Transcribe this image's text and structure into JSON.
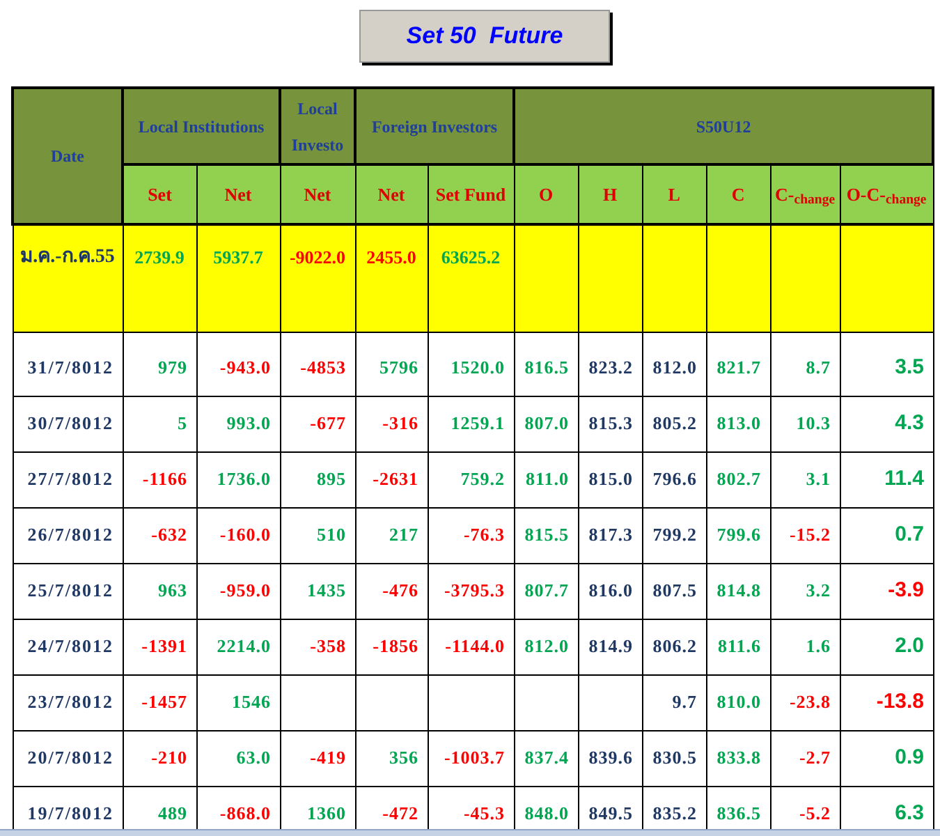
{
  "title": "Set 50  Future",
  "header": {
    "groups": [
      "Date",
      "Local Institutions",
      "Local Investo",
      "Foreign Investors",
      "S50U12"
    ],
    "columns": [
      "Set",
      "Net",
      "Net",
      "Net",
      "Set Fund",
      "O",
      "H",
      "L",
      "C",
      "C-$_{change}$",
      "O-C-$_{change}$"
    ]
  },
  "summary": {
    "label": "ม.ค.-ก.ค.55",
    "values": [
      {
        "text": "2739.9",
        "color": "#00a651"
      },
      {
        "text": "5937.7",
        "color": "#00a651"
      },
      {
        "text": "-9022.0",
        "color": "#ff0000"
      },
      {
        "text": "2455.0",
        "color": "#ff0000"
      },
      {
        "text": "63625.2",
        "color": "#00a651"
      }
    ]
  },
  "rows": [
    {
      "date": "31/7/8012",
      "cells": [
        {
          "text": "979",
          "color": "#00a651"
        },
        {
          "text": "-943.0",
          "color": "#ff0000"
        },
        {
          "text": "-4853",
          "color": "#ff0000"
        },
        {
          "text": "5796",
          "color": "#00a651"
        },
        {
          "text": "1520.0",
          "color": "#00a651"
        },
        {
          "text": "816.5",
          "color": "#00a651"
        },
        {
          "text": "823.2",
          "color": "#1f3864"
        },
        {
          "text": "812.0",
          "color": "#1f3864"
        },
        {
          "text": "821.7",
          "color": "#00a651"
        },
        {
          "text": "8.7",
          "color": "#00a651"
        },
        {
          "text": "3.5",
          "color": "#00a651"
        }
      ]
    },
    {
      "date": "30/7/8012",
      "cells": [
        {
          "text": "5",
          "color": "#00a651"
        },
        {
          "text": "993.0",
          "color": "#00a651"
        },
        {
          "text": "-677",
          "color": "#ff0000"
        },
        {
          "text": "-316",
          "color": "#ff0000"
        },
        {
          "text": "1259.1",
          "color": "#00a651"
        },
        {
          "text": "807.0",
          "color": "#00a651"
        },
        {
          "text": "815.3",
          "color": "#1f3864"
        },
        {
          "text": "805.2",
          "color": "#1f3864"
        },
        {
          "text": "813.0",
          "color": "#00a651"
        },
        {
          "text": "10.3",
          "color": "#00a651"
        },
        {
          "text": "4.3",
          "color": "#00a651"
        }
      ]
    },
    {
      "date": "27/7/8012",
      "cells": [
        {
          "text": "-1166",
          "color": "#ff0000"
        },
        {
          "text": "1736.0",
          "color": "#00a651"
        },
        {
          "text": "895",
          "color": "#00a651"
        },
        {
          "text": "-2631",
          "color": "#ff0000"
        },
        {
          "text": "759.2",
          "color": "#00a651"
        },
        {
          "text": "811.0",
          "color": "#00a651"
        },
        {
          "text": "815.0",
          "color": "#1f3864"
        },
        {
          "text": "796.6",
          "color": "#1f3864"
        },
        {
          "text": "802.7",
          "color": "#00a651"
        },
        {
          "text": "3.1",
          "color": "#00a651"
        },
        {
          "text": "11.4",
          "color": "#00a651"
        }
      ]
    },
    {
      "date": "26/7/8012",
      "cells": [
        {
          "text": "-632",
          "color": "#ff0000"
        },
        {
          "text": "-160.0",
          "color": "#ff0000"
        },
        {
          "text": "510",
          "color": "#00a651"
        },
        {
          "text": "217",
          "color": "#00a651"
        },
        {
          "text": "-76.3",
          "color": "#ff0000"
        },
        {
          "text": "815.5",
          "color": "#00a651"
        },
        {
          "text": "817.3",
          "color": "#1f3864"
        },
        {
          "text": "799.2",
          "color": "#1f3864"
        },
        {
          "text": "799.6",
          "color": "#00a651"
        },
        {
          "text": "-15.2",
          "color": "#ff0000"
        },
        {
          "text": "0.7",
          "color": "#00a651"
        }
      ]
    },
    {
      "date": "25/7/8012",
      "cells": [
        {
          "text": "963",
          "color": "#00a651"
        },
        {
          "text": "-959.0",
          "color": "#ff0000"
        },
        {
          "text": "1435",
          "color": "#00a651"
        },
        {
          "text": "-476",
          "color": "#ff0000"
        },
        {
          "text": "-3795.3",
          "color": "#ff0000"
        },
        {
          "text": "807.7",
          "color": "#00a651"
        },
        {
          "text": "816.0",
          "color": "#1f3864"
        },
        {
          "text": "807.5",
          "color": "#1f3864"
        },
        {
          "text": "814.8",
          "color": "#00a651"
        },
        {
          "text": "3.2",
          "color": "#00a651"
        },
        {
          "text": "-3.9",
          "color": "#ff0000"
        }
      ]
    },
    {
      "date": "24/7/8012",
      "cells": [
        {
          "text": "-1391",
          "color": "#ff0000"
        },
        {
          "text": "2214.0",
          "color": "#00a651"
        },
        {
          "text": "-358",
          "color": "#ff0000"
        },
        {
          "text": "-1856",
          "color": "#ff0000"
        },
        {
          "text": "-1144.0",
          "color": "#ff0000"
        },
        {
          "text": "812.0",
          "color": "#00a651"
        },
        {
          "text": "814.9",
          "color": "#1f3864"
        },
        {
          "text": "806.2",
          "color": "#1f3864"
        },
        {
          "text": "811.6",
          "color": "#00a651"
        },
        {
          "text": "1.6",
          "color": "#00a651"
        },
        {
          "text": "2.0",
          "color": "#00a651"
        }
      ]
    },
    {
      "date": "23/7/8012",
      "cells": [
        {
          "text": "-1457",
          "color": "#ff0000"
        },
        {
          "text": "1546",
          "color": "#00a651"
        },
        null,
        null,
        null,
        null,
        null,
        {
          "text": "9.7",
          "color": "#1f3864"
        },
        {
          "text": "810.0",
          "color": "#00a651"
        },
        {
          "text": "-23.8",
          "color": "#ff0000"
        },
        {
          "text": "-13.8",
          "color": "#ff0000"
        }
      ]
    },
    {
      "date": "20/7/8012",
      "cells": [
        {
          "text": "-210",
          "color": "#ff0000"
        },
        {
          "text": "63.0",
          "color": "#00a651"
        },
        {
          "text": "-419",
          "color": "#ff0000"
        },
        {
          "text": "356",
          "color": "#00a651"
        },
        {
          "text": "-1003.7",
          "color": "#ff0000"
        },
        {
          "text": "837.4",
          "color": "#00a651"
        },
        {
          "text": "839.6",
          "color": "#1f3864"
        },
        {
          "text": "830.5",
          "color": "#1f3864"
        },
        {
          "text": "833.8",
          "color": "#00a651"
        },
        {
          "text": "-2.7",
          "color": "#ff0000"
        },
        {
          "text": "0.9",
          "color": "#00a651"
        }
      ]
    },
    {
      "date": "19/7/8012",
      "cells": [
        {
          "text": "489",
          "color": "#00a651"
        },
        {
          "text": "-868.0",
          "color": "#ff0000"
        },
        {
          "text": "1360",
          "color": "#00a651"
        },
        {
          "text": "-472",
          "color": "#ff0000"
        },
        {
          "text": "-45.3",
          "color": "#ff0000"
        },
        {
          "text": "848.0",
          "color": "#00a651"
        },
        {
          "text": "849.5",
          "color": "#1f3864"
        },
        {
          "text": "835.2",
          "color": "#1f3864"
        },
        {
          "text": "836.5",
          "color": "#00a651"
        },
        {
          "text": "-5.2",
          "color": "#ff0000"
        },
        {
          "text": "6.3",
          "color": "#00a651"
        }
      ]
    }
  ]
}
